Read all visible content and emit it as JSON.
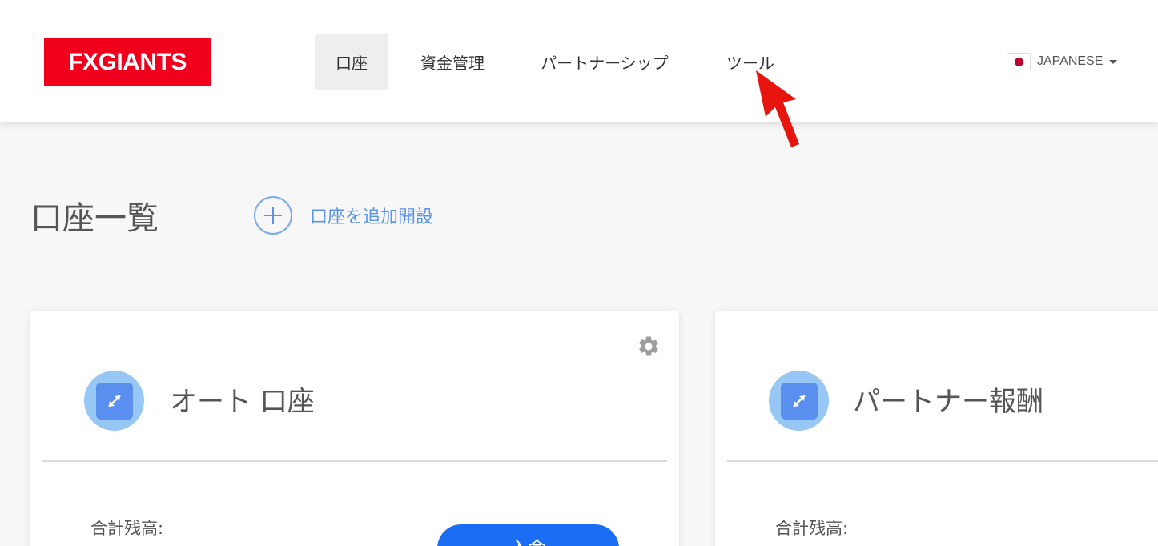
{
  "header": {
    "logo_text": "FXGIANTS",
    "nav": [
      {
        "label": "口座",
        "active": true
      },
      {
        "label": "資金管理",
        "active": false
      },
      {
        "label": "パートナーシップ",
        "active": false
      },
      {
        "label": "ツール",
        "active": false
      }
    ],
    "language": {
      "label": "JAPANESE",
      "flag": "japan-flag-icon"
    }
  },
  "main": {
    "title": "口座一覧",
    "add_account_label": "口座を追加開設",
    "cards": [
      {
        "title": "オート 口座",
        "balance_label": "合計残高:",
        "deposit_label": "入金",
        "icon": "expand-arrows-icon"
      },
      {
        "title": "パートナー報酬",
        "balance_label": "合計残高:",
        "icon": "expand-arrows-icon"
      }
    ]
  },
  "colors": {
    "brand": "#f0001c",
    "accent": "#1b6ef3",
    "link": "#5b93ea",
    "cursor": "#e8140e"
  }
}
